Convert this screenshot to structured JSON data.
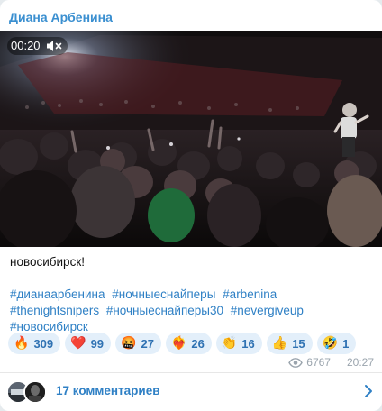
{
  "post": {
    "channel_name": "Диана Арбенина",
    "video": {
      "duration": "00:20",
      "mute_icon": "speaker-muted-icon"
    },
    "text": "новосибирск!",
    "hashtags": [
      "#дианаарбенина",
      "#ночныеснайперы",
      "#arbenina",
      "#thenightsnipers",
      "#ночныеснайперы30",
      "#nevergiveup",
      "#новосибирск"
    ],
    "reactions": [
      {
        "emoji": "🔥",
        "name": "fire",
        "count": "309"
      },
      {
        "emoji": "❤️",
        "name": "heart",
        "count": "99"
      },
      {
        "emoji": "🤬",
        "name": "cursing-face",
        "count": "27"
      },
      {
        "emoji": "❤️‍🔥",
        "name": "heart-on-fire",
        "count": "26"
      },
      {
        "emoji": "👏",
        "name": "clapping-hands",
        "count": "16"
      },
      {
        "emoji": "👍",
        "name": "thumbs-up",
        "count": "15"
      },
      {
        "emoji": "🤣",
        "name": "rolling-laughing",
        "count": "1"
      }
    ],
    "views": "6767",
    "time": "20:27"
  },
  "comments": {
    "label": "17 комментариев",
    "icon": "chevron-right-icon"
  },
  "colors": {
    "accent": "#2f80c5",
    "channel_name": "#3a8fd0",
    "reaction_bg": "#e3effa",
    "meta": "#9aa4ad"
  }
}
